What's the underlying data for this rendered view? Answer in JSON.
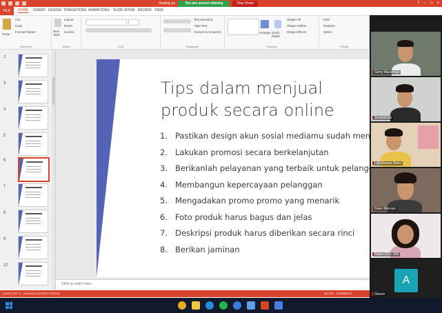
{
  "titlebar": {
    "file_name": "Strategi pe",
    "sharing_text": "You are screen sharing",
    "stop_share": "Stop Share",
    "brand": "#d9432c"
  },
  "tabs": [
    "FILE",
    "HOME",
    "INSERT",
    "DESIGN",
    "TRANSITIONS",
    "ANIMATIONS",
    "SLIDE SHOW",
    "REVIEW",
    "VIEW"
  ],
  "ribbon": {
    "clipboard": {
      "label": "Clipboard",
      "paste": "Paste",
      "cut": "Cut",
      "copy": "Copy",
      "format_painter": "Format Painter"
    },
    "slides": {
      "label": "Slides",
      "new_slide": "New Slide",
      "layout": "Layout",
      "reset": "Reset",
      "section": "Section"
    },
    "font": {
      "label": "Font"
    },
    "paragraph": {
      "label": "Paragraph",
      "text_direction": "Text Direction",
      "align_text": "Align Text",
      "smartart": "Convert to SmartArt"
    },
    "drawing": {
      "label": "Drawing",
      "arrange": "Arrange",
      "quick_styles": "Quick Styles",
      "shape_fill": "Shape Fill",
      "shape_outline": "Shape Outline",
      "shape_effects": "Shape Effects"
    },
    "editing": {
      "label": "Editing",
      "find": "Find",
      "replace": "Replace",
      "select": "Select"
    }
  },
  "thumbnails": [
    "2",
    "3",
    "4",
    "5",
    "6",
    "7",
    "8",
    "9",
    "10"
  ],
  "selected_thumbnail": "6",
  "slide": {
    "title": "Tips dalam menjual produk secara online",
    "items": [
      {
        "n": "1.",
        "text": "Pastikan design akun sosial mediamu sudah menari"
      },
      {
        "n": "2.",
        "text": "Lakukan promosi secara berkelanjutan"
      },
      {
        "n": "3.",
        "text": "Berikanlah pelayanan yang terbaik untuk pelanggan"
      },
      {
        "n": "4.",
        "text": "Membangun kepercayaan pelanggan"
      },
      {
        "n": "5.",
        "text": "Mengadakan promo promo yang menarik"
      },
      {
        "n": "6.",
        "text": "Foto produk harus bagus dan jelas"
      },
      {
        "n": "7.",
        "text": "Deskripsi produk harus diberikan secara rinci"
      },
      {
        "n": "8.",
        "text": "Berikan jaminan"
      }
    ]
  },
  "notes_placeholder": "Click to add notes",
  "status": {
    "slide": "SLIDE 6 OF 11",
    "language": "ENGLISH (UNITED STATES)",
    "notes": "NOTES",
    "comments": "COMMENTS"
  },
  "participants": [
    {
      "name": "Gerry Manoreas",
      "tile_bg": "#6f7a6c",
      "shirt": "#ececec"
    },
    {
      "name": "Jordanicais",
      "tile_bg": "#cfd2cf",
      "shirt": "#2b2b2b"
    },
    {
      "name": "Labalbeanu Bario",
      "tile_bg": "#e3d2b8",
      "shirt": "#e8c24a"
    },
    {
      "name": "Dean Menoyo",
      "tile_bg": "#7d6a5e",
      "shirt": "#3a3a3a"
    },
    {
      "name": "Rahel 233 / 362",
      "tile_bg": "#efe8ea",
      "shirt": "#d8a7b6"
    },
    {
      "name": "Steven",
      "avatar_letter": "A",
      "avatar_color": "#1aa3b5"
    }
  ]
}
